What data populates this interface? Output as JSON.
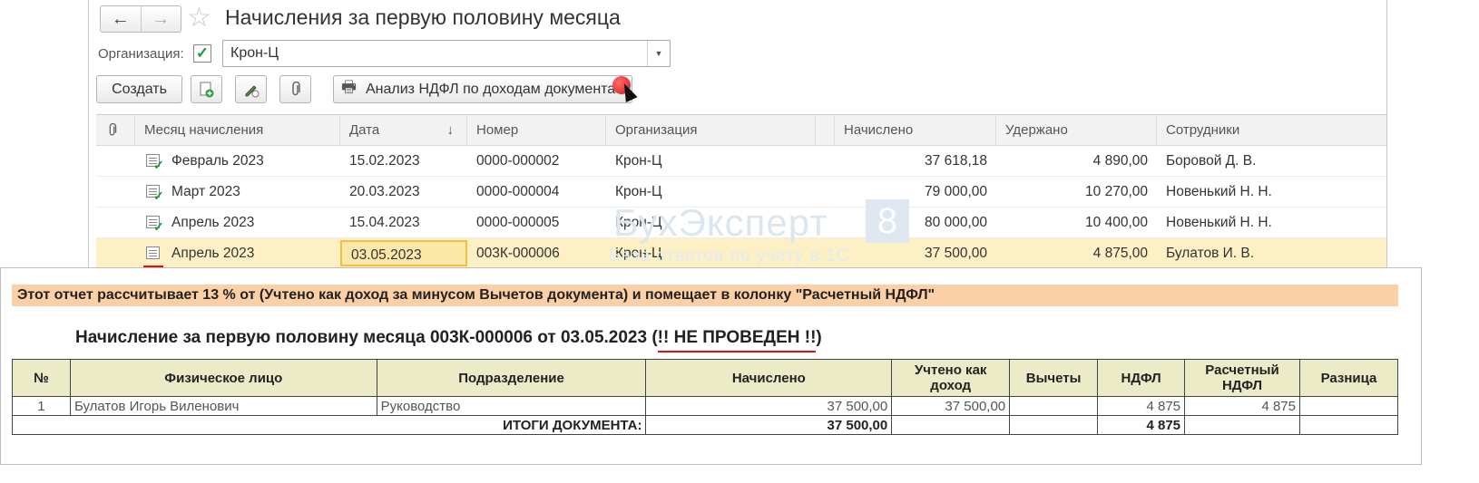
{
  "window": {
    "title": "Начисления за первую половину месяца",
    "org_label": "Организация:",
    "org_value": "Крон-Ц",
    "create_label": "Создать",
    "report_label": "Анализ НДФЛ по доходам документа"
  },
  "columns": {
    "month": "Месяц начисления",
    "date": "Дата",
    "number": "Номер",
    "org": "Организация",
    "accrued": "Начислено",
    "withheld": "Удержано",
    "employees": "Сотрудники"
  },
  "rows": [
    {
      "month": "Февраль 2023",
      "date": "15.02.2023",
      "number": "0000-000002",
      "org": "Крон-Ц",
      "accrued": "37 618,18",
      "withheld": "4 890,00",
      "employees": "Боровой Д. В."
    },
    {
      "month": "Март 2023",
      "date": "20.03.2023",
      "number": "0000-000004",
      "org": "Крон-Ц",
      "accrued": "79 000,00",
      "withheld": "10 270,00",
      "employees": "Новенький Н. Н."
    },
    {
      "month": "Апрель 2023",
      "date": "15.04.2023",
      "number": "0000-000005",
      "org": "Крон-Ц",
      "accrued": "80 000,00",
      "withheld": "10 400,00",
      "employees": "Новенький Н. Н."
    },
    {
      "month": "Апрель 2023",
      "date": "03.05.2023",
      "number": "003К-000006",
      "org": "Крон-Ц",
      "accrued": "37 500,00",
      "withheld": "4 875,00",
      "employees": "Булатов И. В."
    }
  ],
  "watermark": {
    "brand": "БухЭксперт",
    "digit": "8",
    "tagline": "База ответов по учету в 1С"
  },
  "report": {
    "banner": "Этот отчет рассчитывает 13 % от (Учтено как доход за минусом Вычетов документа)  и помещает в колонку \"Расчетный НДФЛ\"",
    "title_prefix": "Начисление за первую половину месяца 003К-000006 от 03.05.2023 (",
    "title_status": "!! НЕ ПРОВЕДЕН !!",
    "title_suffix": ")",
    "headers": {
      "num": "№",
      "person": "Физическое лицо",
      "dept": "Подразделение",
      "accrued": "Начислено",
      "income": "Учтено как доход",
      "deductions": "Вычеты",
      "ndfl": "НДФЛ",
      "calc_ndfl": "Расчетный НДФЛ",
      "diff": "Разница"
    },
    "row": {
      "num": "1",
      "person": "Булатов Игорь Виленович",
      "dept": "Руководство",
      "accrued": "37 500,00",
      "income": "37 500,00",
      "deductions": "",
      "ndfl": "4 875",
      "calc_ndfl": "4 875",
      "diff": ""
    },
    "totals": {
      "label": "ИТОГИ ДОКУМЕНТА:",
      "accrued": "37 500,00",
      "ndfl": "4 875"
    }
  }
}
